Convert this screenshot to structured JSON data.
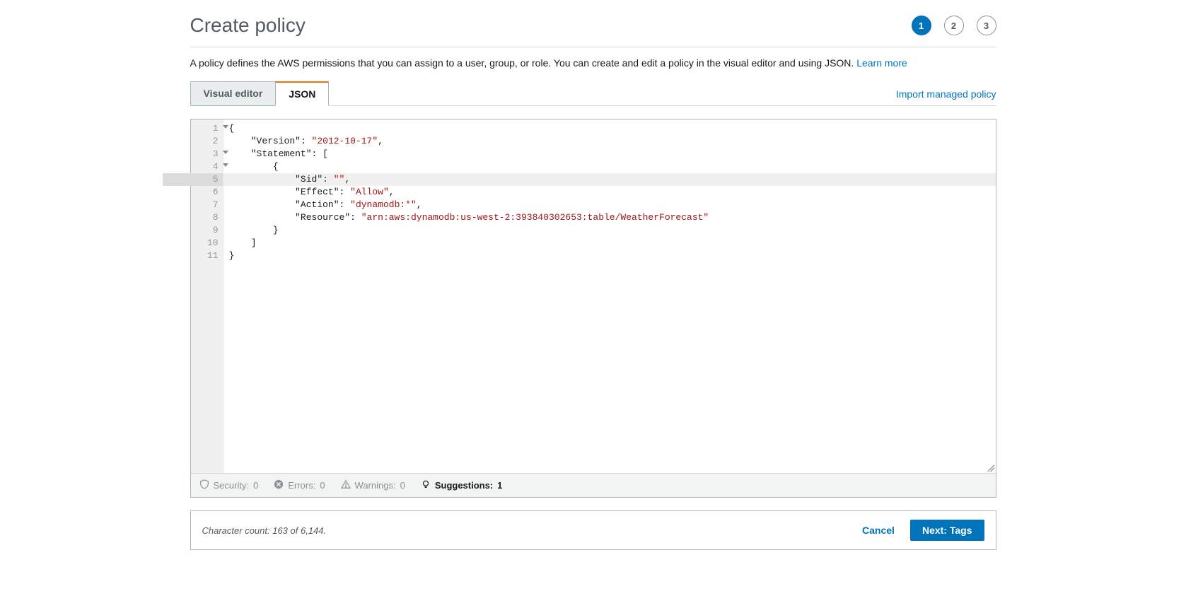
{
  "header": {
    "title": "Create policy",
    "steps": [
      "1",
      "2",
      "3"
    ],
    "active_step_index": 0
  },
  "description": {
    "text": "A policy defines the AWS permissions that you can assign to a user, group, or role. You can create and edit a policy in the visual editor and using JSON. ",
    "link": "Learn more"
  },
  "tabs": {
    "items": [
      "Visual editor",
      "JSON"
    ],
    "active_index": 1,
    "import_link": "Import managed policy"
  },
  "editor": {
    "line_numbers": [
      "1",
      "2",
      "3",
      "4",
      "5",
      "6",
      "7",
      "8",
      "9",
      "10",
      "11"
    ],
    "fold_lines": [
      0,
      2,
      3
    ],
    "active_line_index": 4,
    "policy": {
      "Version": "2012-10-17",
      "Statement": [
        {
          "Sid": "",
          "Effect": "Allow",
          "Action": "dynamodb:*",
          "Resource": "arn:aws:dynamodb:us-west-2:393840302653:table/WeatherForecast"
        }
      ]
    }
  },
  "status_bar": {
    "security": {
      "label": "Security:",
      "count": "0"
    },
    "errors": {
      "label": "Errors:",
      "count": "0"
    },
    "warnings": {
      "label": "Warnings:",
      "count": "0"
    },
    "suggestions": {
      "label": "Suggestions:",
      "count": "1"
    }
  },
  "footer": {
    "char_count_label": "Character count: 163 of 6,144.",
    "cancel": "Cancel",
    "next": "Next: Tags"
  }
}
